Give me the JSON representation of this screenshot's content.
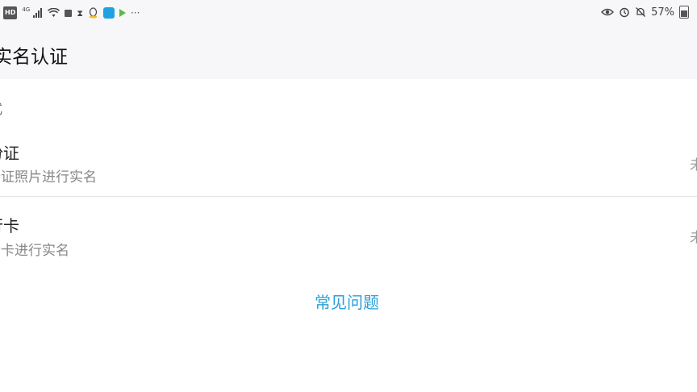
{
  "status_bar": {
    "left_icons": [
      "hd-badge",
      "network-4g",
      "signal-bars",
      "wifi",
      "square-notification",
      "hourglass",
      "qq",
      "app-blue",
      "video-play",
      "more-dots"
    ],
    "network_label": "4G",
    "hd_label": "HD",
    "more_label": "···",
    "battery_percent": "57%",
    "right_icons": [
      "eye-comfort",
      "alarm",
      "mute-bell",
      "battery"
    ]
  },
  "header": {
    "title": "实名认证"
  },
  "section": {
    "label": "式"
  },
  "options": [
    {
      "title": "份证",
      "subtitle": "份证照片进行实名",
      "status": "未"
    },
    {
      "title": "行卡",
      "subtitle": "行卡进行实名",
      "status": "未"
    }
  ],
  "faq": {
    "label": "常见问题",
    "color": "#2b9fd9"
  }
}
